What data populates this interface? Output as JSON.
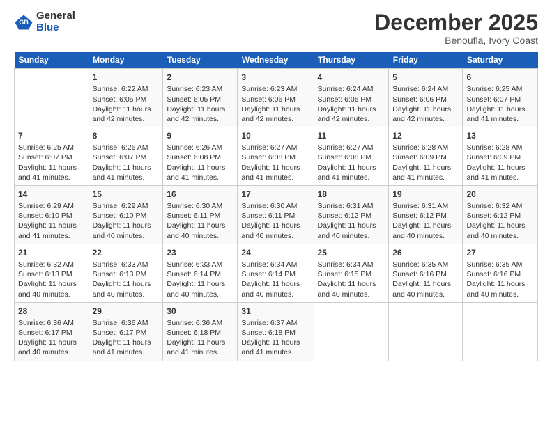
{
  "header": {
    "logo_line1": "General",
    "logo_line2": "Blue",
    "title": "December 2025",
    "subtitle": "Benoufla, Ivory Coast"
  },
  "calendar": {
    "days_of_week": [
      "Sunday",
      "Monday",
      "Tuesday",
      "Wednesday",
      "Thursday",
      "Friday",
      "Saturday"
    ],
    "weeks": [
      [
        {
          "day": "",
          "content": ""
        },
        {
          "day": "1",
          "content": "Sunrise: 6:22 AM\nSunset: 6:05 PM\nDaylight: 11 hours\nand 42 minutes."
        },
        {
          "day": "2",
          "content": "Sunrise: 6:23 AM\nSunset: 6:05 PM\nDaylight: 11 hours\nand 42 minutes."
        },
        {
          "day": "3",
          "content": "Sunrise: 6:23 AM\nSunset: 6:06 PM\nDaylight: 11 hours\nand 42 minutes."
        },
        {
          "day": "4",
          "content": "Sunrise: 6:24 AM\nSunset: 6:06 PM\nDaylight: 11 hours\nand 42 minutes."
        },
        {
          "day": "5",
          "content": "Sunrise: 6:24 AM\nSunset: 6:06 PM\nDaylight: 11 hours\nand 42 minutes."
        },
        {
          "day": "6",
          "content": "Sunrise: 6:25 AM\nSunset: 6:07 PM\nDaylight: 11 hours\nand 41 minutes."
        }
      ],
      [
        {
          "day": "7",
          "content": "Sunrise: 6:25 AM\nSunset: 6:07 PM\nDaylight: 11 hours\nand 41 minutes."
        },
        {
          "day": "8",
          "content": "Sunrise: 6:26 AM\nSunset: 6:07 PM\nDaylight: 11 hours\nand 41 minutes."
        },
        {
          "day": "9",
          "content": "Sunrise: 6:26 AM\nSunset: 6:08 PM\nDaylight: 11 hours\nand 41 minutes."
        },
        {
          "day": "10",
          "content": "Sunrise: 6:27 AM\nSunset: 6:08 PM\nDaylight: 11 hours\nand 41 minutes."
        },
        {
          "day": "11",
          "content": "Sunrise: 6:27 AM\nSunset: 6:08 PM\nDaylight: 11 hours\nand 41 minutes."
        },
        {
          "day": "12",
          "content": "Sunrise: 6:28 AM\nSunset: 6:09 PM\nDaylight: 11 hours\nand 41 minutes."
        },
        {
          "day": "13",
          "content": "Sunrise: 6:28 AM\nSunset: 6:09 PM\nDaylight: 11 hours\nand 41 minutes."
        }
      ],
      [
        {
          "day": "14",
          "content": "Sunrise: 6:29 AM\nSunset: 6:10 PM\nDaylight: 11 hours\nand 41 minutes."
        },
        {
          "day": "15",
          "content": "Sunrise: 6:29 AM\nSunset: 6:10 PM\nDaylight: 11 hours\nand 40 minutes."
        },
        {
          "day": "16",
          "content": "Sunrise: 6:30 AM\nSunset: 6:11 PM\nDaylight: 11 hours\nand 40 minutes."
        },
        {
          "day": "17",
          "content": "Sunrise: 6:30 AM\nSunset: 6:11 PM\nDaylight: 11 hours\nand 40 minutes."
        },
        {
          "day": "18",
          "content": "Sunrise: 6:31 AM\nSunset: 6:12 PM\nDaylight: 11 hours\nand 40 minutes."
        },
        {
          "day": "19",
          "content": "Sunrise: 6:31 AM\nSunset: 6:12 PM\nDaylight: 11 hours\nand 40 minutes."
        },
        {
          "day": "20",
          "content": "Sunrise: 6:32 AM\nSunset: 6:12 PM\nDaylight: 11 hours\nand 40 minutes."
        }
      ],
      [
        {
          "day": "21",
          "content": "Sunrise: 6:32 AM\nSunset: 6:13 PM\nDaylight: 11 hours\nand 40 minutes."
        },
        {
          "day": "22",
          "content": "Sunrise: 6:33 AM\nSunset: 6:13 PM\nDaylight: 11 hours\nand 40 minutes."
        },
        {
          "day": "23",
          "content": "Sunrise: 6:33 AM\nSunset: 6:14 PM\nDaylight: 11 hours\nand 40 minutes."
        },
        {
          "day": "24",
          "content": "Sunrise: 6:34 AM\nSunset: 6:14 PM\nDaylight: 11 hours\nand 40 minutes."
        },
        {
          "day": "25",
          "content": "Sunrise: 6:34 AM\nSunset: 6:15 PM\nDaylight: 11 hours\nand 40 minutes."
        },
        {
          "day": "26",
          "content": "Sunrise: 6:35 AM\nSunset: 6:16 PM\nDaylight: 11 hours\nand 40 minutes."
        },
        {
          "day": "27",
          "content": "Sunrise: 6:35 AM\nSunset: 6:16 PM\nDaylight: 11 hours\nand 40 minutes."
        }
      ],
      [
        {
          "day": "28",
          "content": "Sunrise: 6:36 AM\nSunset: 6:17 PM\nDaylight: 11 hours\nand 40 minutes."
        },
        {
          "day": "29",
          "content": "Sunrise: 6:36 AM\nSunset: 6:17 PM\nDaylight: 11 hours\nand 41 minutes."
        },
        {
          "day": "30",
          "content": "Sunrise: 6:36 AM\nSunset: 6:18 PM\nDaylight: 11 hours\nand 41 minutes."
        },
        {
          "day": "31",
          "content": "Sunrise: 6:37 AM\nSunset: 6:18 PM\nDaylight: 11 hours\nand 41 minutes."
        },
        {
          "day": "",
          "content": ""
        },
        {
          "day": "",
          "content": ""
        },
        {
          "day": "",
          "content": ""
        }
      ]
    ]
  }
}
